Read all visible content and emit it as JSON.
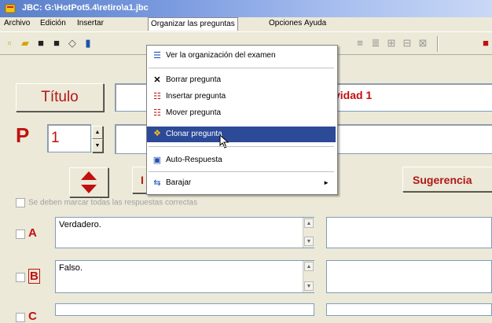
{
  "window": {
    "title": "JBC: G:\\HotPot5.4\\retiro\\a1.jbc"
  },
  "menu": [
    "Archivo",
    "Edición",
    "Insertar",
    "Organizar las preguntas",
    "Opciones",
    "Ayuda"
  ],
  "dropdown": {
    "items": [
      {
        "label": "Ver la organización del examen",
        "icon": "list-icon"
      },
      {
        "label": "Borrar pregunta",
        "icon": "delete-icon"
      },
      {
        "label": "Insertar pregunta",
        "icon": "insert-icon"
      },
      {
        "label": "Mover pregunta",
        "icon": "move-icon"
      },
      {
        "label": "Clonar pregunta",
        "icon": "clone-icon",
        "highlighted": true
      },
      {
        "label": "Auto-Respuesta",
        "icon": "auto-answer-icon"
      },
      {
        "label": "Barajar",
        "icon": "shuffle-icon",
        "submenu": true
      }
    ]
  },
  "form": {
    "titulo_button": "Título",
    "title_value": "vidad 1",
    "p_label": "P",
    "question_number": "1",
    "partial_button_letter": "I",
    "sugerencia_button": "Sugerencia",
    "all_correct_label": "Se deben marcar todas las respuestas correctas",
    "options": [
      {
        "letter": "A",
        "text": "Verdadero."
      },
      {
        "letter": "B",
        "text": "Falso."
      },
      {
        "letter": "C",
        "text": ""
      }
    ]
  },
  "colors": {
    "accent_red": "#c01010",
    "menu_highlight": "#2c4a98",
    "titlebar": "#5a7fc8"
  }
}
